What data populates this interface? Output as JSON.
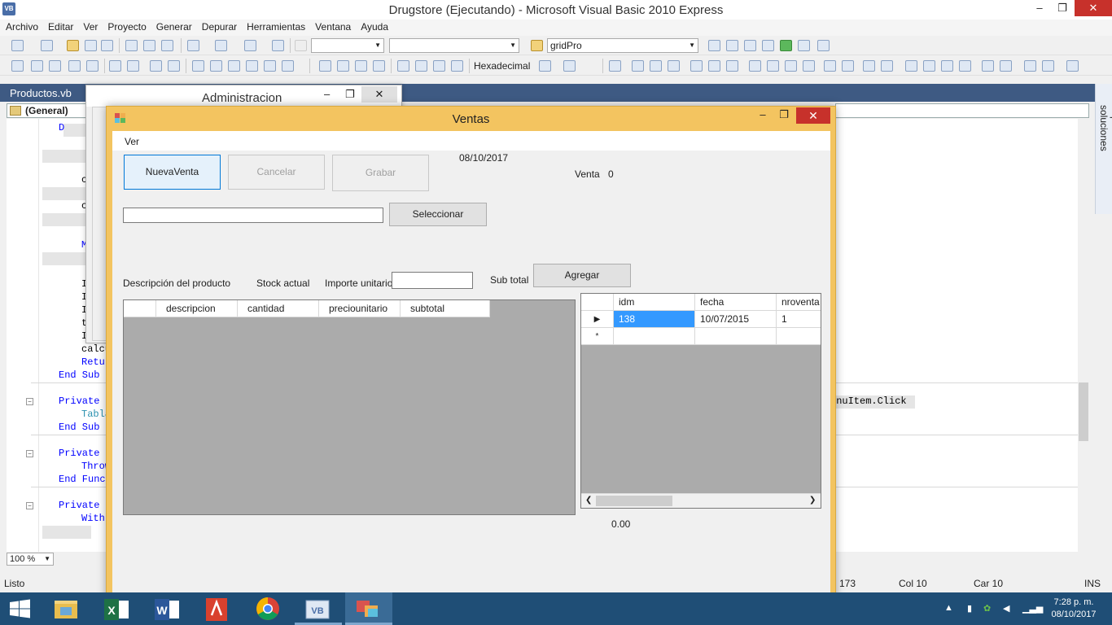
{
  "ide": {
    "title": "Drugstore (Ejecutando) - Microsoft Visual Basic 2010 Express",
    "app_icon_text": "VB",
    "minimize_glyph": "–",
    "maximize_glyph": "❐",
    "close_glyph": "✕",
    "menu": [
      "Archivo",
      "Editar",
      "Ver",
      "Proyecto",
      "Generar",
      "Depurar",
      "Herramientas",
      "Ventana",
      "Ayuda"
    ],
    "toolbar": {
      "find_combo_value": "gridPro",
      "number_format": "Hexadecimal"
    },
    "document_tab": "Productos.vb",
    "general_combo": "(General)",
    "solution_explorer": "Explorador de soluciones",
    "zoom": "100 %",
    "code_tail": "enuItem.Click",
    "status": {
      "left": "Listo",
      "line": "173",
      "col": "Col 10",
      "car": "Car 10",
      "mode": "INS"
    }
  },
  "code_lines": [
    {
      "indent": "        ",
      "kw": "",
      "rest": "D"
    },
    {
      "indent": "        ",
      "kw": "",
      "rest": "c"
    },
    {
      "indent": "        ",
      "kw": "",
      "rest": "c"
    },
    {
      "indent": "        ",
      "kw": "M",
      "rest": ""
    },
    {
      "indent": "        ",
      "kw": "",
      "rest": "I"
    },
    {
      "indent": "        ",
      "kw": "",
      "rest": "I"
    },
    {
      "indent": "        ",
      "kw": "",
      "rest": "I"
    },
    {
      "indent": "        ",
      "kw": "",
      "rest": "t"
    },
    {
      "indent": "        ",
      "kw": "",
      "rest": "I"
    },
    {
      "indent": "        ",
      "kw": "",
      "rest": "calcu"
    },
    {
      "indent": "        ",
      "kw": "Retur",
      "rest": ""
    },
    {
      "indent": "    ",
      "kw": "End Sub",
      "rest": ""
    },
    {
      "indent": "    ",
      "kw": "Private S",
      "rest": ""
    },
    {
      "indent": "        ",
      "kw": "",
      "rest": "Tabla"
    },
    {
      "indent": "    ",
      "kw": "End Sub",
      "rest": ""
    },
    {
      "indent": "    ",
      "kw": "Private F",
      "rest": ""
    },
    {
      "indent": "        ",
      "kw": "Throw",
      "rest": ""
    },
    {
      "indent": "    ",
      "kw": "End Funct",
      "rest": ""
    },
    {
      "indent": "    ",
      "kw": "Private S",
      "rest": ""
    },
    {
      "indent": "        ",
      "kw": "With",
      "rest": ""
    }
  ],
  "admin_window": {
    "title": "Administracion"
  },
  "ventas": {
    "title": "Ventas",
    "menu_ver": "Ver",
    "btn_nueva": "NuevaVenta",
    "btn_cancelar": "Cancelar",
    "btn_grabar": "Grabar",
    "date": "08/10/2017",
    "venta_label": "Venta",
    "venta_value": "0",
    "btn_seleccionar": "Seleccionar",
    "lbl_descripcion": "Descripción del producto",
    "lbl_stock": "Stock actual",
    "lbl_importe": "Importe unitario",
    "lbl_subtotal": "Sub total",
    "btn_agregar": "Agregar",
    "total": "0.00",
    "items_grid": {
      "columns": [
        "descripcion",
        "cantidad",
        "preciounitario",
        "subtotal"
      ]
    },
    "ventas_grid": {
      "columns": [
        "idm",
        "fecha",
        "nroventa"
      ],
      "rows": [
        [
          "138",
          "10/07/2015",
          "1"
        ]
      ],
      "new_row_marker": "*",
      "current_row_marker": "▶"
    }
  },
  "taskbar": {
    "time": "7:28 p. m.",
    "date": "08/10/2017",
    "apps": [
      "windows-start",
      "file-explorer",
      "excel",
      "word",
      "acrobat",
      "chrome",
      "visual-basic",
      "running-app"
    ]
  }
}
